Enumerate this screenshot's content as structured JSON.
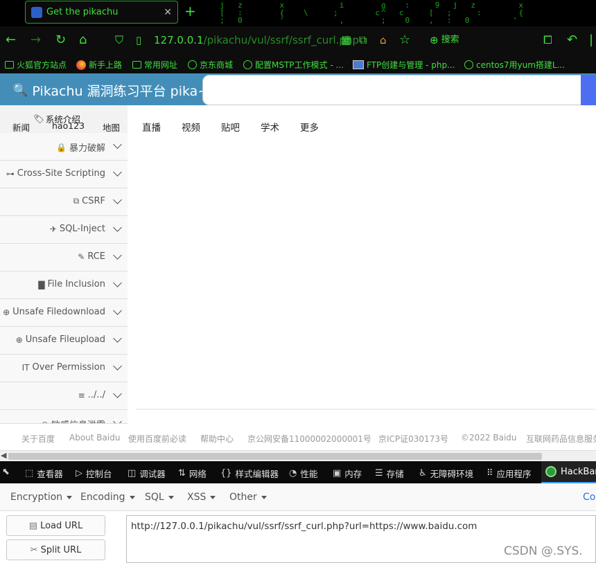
{
  "browser": {
    "tab_title": "Get the pikachu",
    "url_prefix": "127.0.0.1",
    "url_rest": "/pikachu/vul/ssrf/ssrf_curl.php",
    "search_label": "搜索",
    "matrix_text": "  j  z      x         i      g   :    9  j  z       x\n  [  :      {   \\    ;      c^  c    [  ;    :      {\n  ;  0      '         ,      ;   0   ,  :  0       '",
    "bookmarks": [
      "火狐官方站点",
      "新手上路",
      "常用网址",
      "京东商城",
      "配置MSTP工作模式 - ...",
      "FTP创建与管理 - php...",
      "centos7用yum搭建L..."
    ]
  },
  "site": {
    "brand": "Pikachu 漏洞练习平台 pika~",
    "top_nav": [
      "系统介绍",
      "新闻",
      "hao123",
      "地图"
    ],
    "sidebar_items": [
      {
        "icon": "lock-icon",
        "glyph": "🔒",
        "label": "暴力破解"
      },
      {
        "icon": "sitemap-icon",
        "glyph": "⊶",
        "label": "Cross-Site Scripting"
      },
      {
        "icon": "external-link-icon",
        "glyph": "⧉",
        "label": "CSRF"
      },
      {
        "icon": "plane-icon",
        "glyph": "✈",
        "label": "SQL-Inject"
      },
      {
        "icon": "pencil-icon",
        "glyph": "✎",
        "label": "RCE"
      },
      {
        "icon": "file-icon",
        "glyph": "▇",
        "label": "File Inclusion"
      },
      {
        "icon": "download-icon",
        "glyph": "⊕",
        "label": "Unsafe Filedownload"
      },
      {
        "icon": "upload-icon",
        "glyph": "⊕",
        "label": "Unsafe Fileupload"
      },
      {
        "icon": "text-height-icon",
        "glyph": "IT",
        "label": "Over Permission"
      },
      {
        "icon": "align-left-icon",
        "glyph": "≡",
        "label": "../../"
      },
      {
        "icon": "eye-icon",
        "glyph": "◉",
        "label": "敏感信息泄露"
      }
    ]
  },
  "baidu": {
    "nav": [
      "直播",
      "视频",
      "贴吧",
      "学术",
      "更多"
    ],
    "footer": [
      "关于百度",
      "About Baidu",
      "使用百度前必读",
      "帮助中心",
      "京公网安备11000002000001号",
      "京ICP证030173号",
      "©2022 Baidu",
      "互联网药品信息服务"
    ]
  },
  "devtools": {
    "tabs": [
      {
        "icon": "inspector-icon",
        "glyph": "⬚",
        "label": "查看器"
      },
      {
        "icon": "console-icon",
        "glyph": "▷",
        "label": "控制台"
      },
      {
        "icon": "debugger-icon",
        "glyph": "◫",
        "label": "调试器"
      },
      {
        "icon": "network-icon",
        "glyph": "⇅",
        "label": "网络"
      },
      {
        "icon": "style-editor-icon",
        "glyph": "{}",
        "label": "样式编辑器"
      },
      {
        "icon": "performance-icon",
        "glyph": "◔",
        "label": "性能"
      },
      {
        "icon": "memory-icon",
        "glyph": "▣",
        "label": "内存"
      },
      {
        "icon": "storage-icon",
        "glyph": "☰",
        "label": "存储"
      },
      {
        "icon": "accessibility-icon",
        "glyph": "♿",
        "label": "无障碍环境"
      },
      {
        "icon": "application-icon",
        "glyph": "⠿",
        "label": "应用程序"
      }
    ],
    "hackbar_tab": "HackBar"
  },
  "hackbar": {
    "menus": [
      "Encryption",
      "Encoding",
      "SQL",
      "XSS",
      "Other"
    ],
    "menu_right": "Co",
    "load_url": "Load URL",
    "split_url": "Split URL",
    "url_value": "http://127.0.0.1/pikachu/vul/ssrf/ssrf_curl.php?url=https://www.baidu.com"
  },
  "watermark": "CSDN @.SYS."
}
